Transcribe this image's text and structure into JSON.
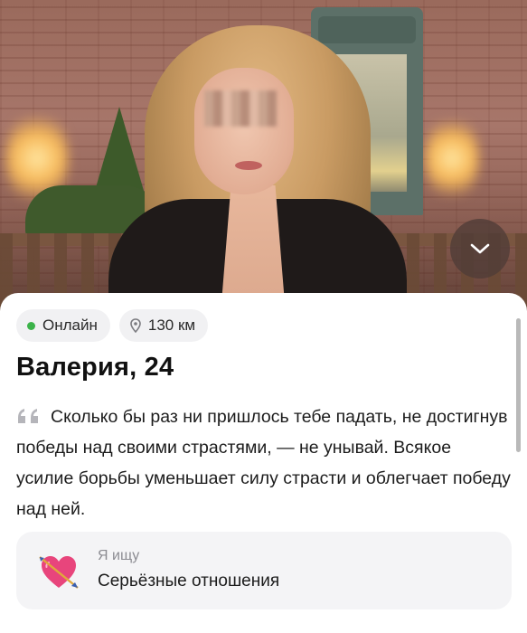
{
  "profile": {
    "photo_alt": "profile-photo",
    "status": {
      "online_label": "Онлайн",
      "online_color": "#3cb34a",
      "distance": "130 км"
    },
    "name_age": "Валерия, 24",
    "bio": "Сколько бы раз ни пришлось тебе падать, не достигнув победы над своими страстями, — не унывай. Всякое усилие борьбы уменьшает силу страсти и облегчает победу над ней.",
    "looking_for": {
      "label": "Я ищу",
      "value": "Серьёзные отношения",
      "icon": "heart-arrow-icon"
    }
  },
  "controls": {
    "collapse_icon": "chevron-down-icon"
  },
  "colors": {
    "chip_bg": "#f1f1f3",
    "card_bg": "#ffffff",
    "heart": "#e8457c"
  }
}
